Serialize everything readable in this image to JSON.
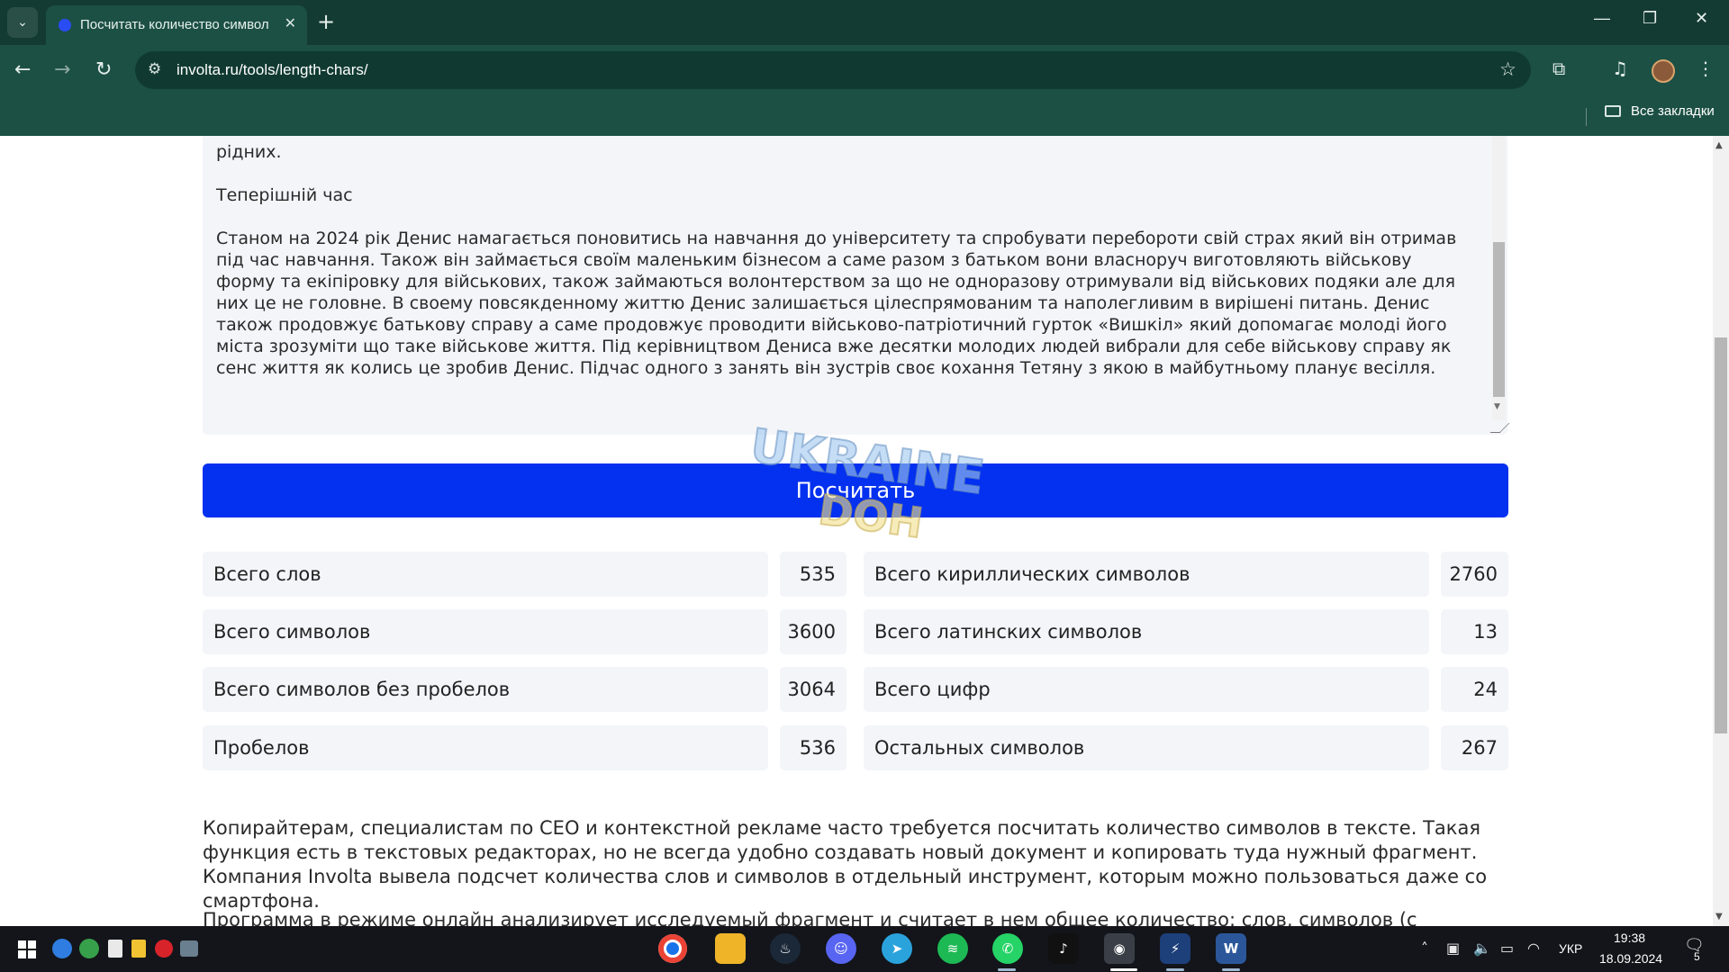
{
  "browser": {
    "tab_title": "Посчитать количество символов",
    "tab_close": "✕",
    "new_tab": "+",
    "url": "involta.ru/tools/length-chars/",
    "bookmarks_label": "Все закладки"
  },
  "textarea": {
    "paragraphs": [
      "рідних.",
      "Теперішній час",
      "Станом на 2024 рік Денис намагається поновитись на навчання до університету та спробувати перебороти свій страх який він отримав під час навчання. Також він займається своїм маленьким бізнесом а саме разом з батьком вони власноруч виготовляють військову форму та екіпіровку для військових, також займаються волонтерством за що не одноразову отримували від військових подяки але для них це не головне.  В своему повсякденному життю Денис залишається цілеспрямованим та наполегливим в вирішені питань. Денис також продовжує батькову справу а саме продовжує проводити  військово-патріотичний гурток «Вишкіл» який допомагає молоді його міста зрозуміти що таке військове життя. Під керівництвом Дениса вже десятки молодих людей вибрали для себе військову справу як сенс життя як колись це зробив Денис. Підчас одного з занять він зустрів своє кохання Тетяну з якою в майбутньому планує весілля."
    ]
  },
  "button": {
    "label": "Посчитать"
  },
  "watermark": {
    "line1": "UKRAINE",
    "line2": "DOH"
  },
  "stats": {
    "left": [
      {
        "label": "Всего слов",
        "value": "535"
      },
      {
        "label": "Всего символов",
        "value": "3600"
      },
      {
        "label": "Всего символов без пробелов",
        "value": "3064"
      },
      {
        "label": "Пробелов",
        "value": "536"
      }
    ],
    "right": [
      {
        "label": "Всего кириллических символов",
        "value": "2760"
      },
      {
        "label": "Всего латинских символов",
        "value": "13"
      },
      {
        "label": "Всего цифр",
        "value": "24"
      },
      {
        "label": "Остальных символов",
        "value": "267"
      }
    ]
  },
  "description": {
    "p1": "Копирайтерам, специалистам по СЕО и контекстной рекламе часто требуется посчитать количество символов в тексте. Такая функция есть в текстовых редакторах, но не всегда удобно создавать новый документ и копировать туда нужный фрагмент. Компания Involta вывела подсчет количества слов и символов в отдельный инструмент, которым можно пользоваться даже со смартфона.",
    "p2": "Программа в режиме онлайн анализирует исследуемый фрагмент и считает в нем общее количество: слов, символов (с пробелами и"
  },
  "taskbar": {
    "language": "УКР",
    "time": "19:38",
    "date": "18.09.2024",
    "notifications": "5"
  },
  "colors": {
    "tabstrip": "#143b33",
    "toolbar": "#1c5045",
    "button": "#0431ef",
    "cell_bg": "#f3f5f9",
    "taskbar": "#13151a"
  }
}
